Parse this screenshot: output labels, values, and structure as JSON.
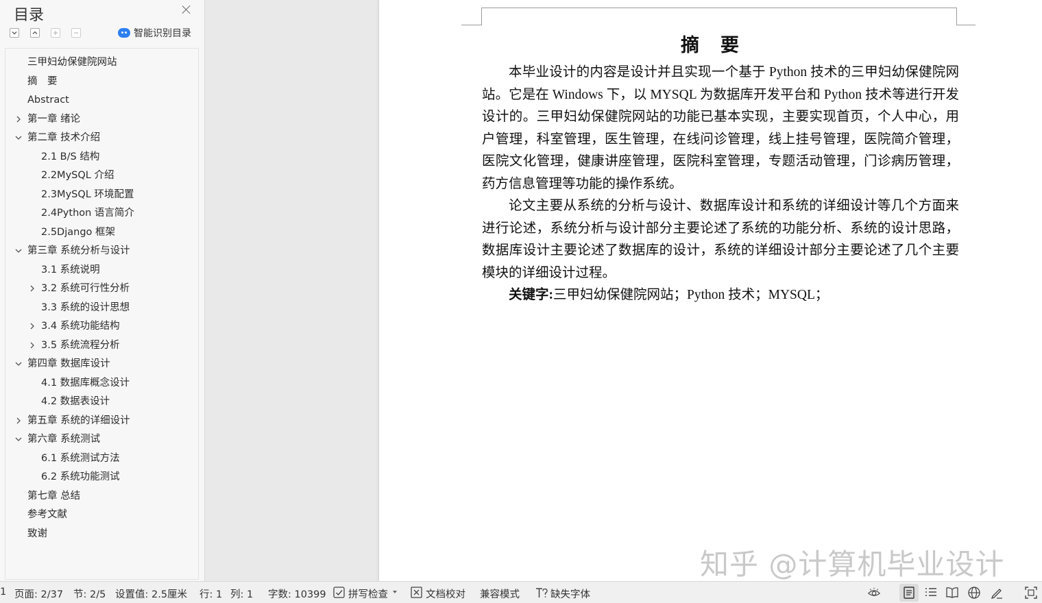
{
  "toc": {
    "title": "目录",
    "smart_toc_label": "智能识别目录",
    "items": [
      {
        "label": "三甲妇幼保健院网站",
        "level": 0,
        "expander": "none"
      },
      {
        "label": "摘　要",
        "level": 0,
        "expander": "none"
      },
      {
        "label": "Abstract",
        "level": 0,
        "expander": "none"
      },
      {
        "label": "第一章 绪论",
        "level": 0,
        "expander": "collapsed"
      },
      {
        "label": "第二章 技术介绍",
        "level": 0,
        "expander": "expanded"
      },
      {
        "label": "2.1 B/S 结构",
        "level": 1,
        "expander": "none"
      },
      {
        "label": "2.2MySQL 介绍",
        "level": 1,
        "expander": "none"
      },
      {
        "label": "2.3MySQL 环境配置",
        "level": 1,
        "expander": "none"
      },
      {
        "label": "2.4Python 语言简介",
        "level": 1,
        "expander": "none"
      },
      {
        "label": "2.5Django 框架",
        "level": 1,
        "expander": "none"
      },
      {
        "label": "第三章 系统分析与设计",
        "level": 0,
        "expander": "expanded"
      },
      {
        "label": "3.1 系统说明",
        "level": 1,
        "expander": "none"
      },
      {
        "label": "3.2 系统可行性分析",
        "level": 1,
        "expander": "collapsed"
      },
      {
        "label": "3.3 系统的设计思想",
        "level": 1,
        "expander": "none"
      },
      {
        "label": "3.4 系统功能结构",
        "level": 1,
        "expander": "collapsed"
      },
      {
        "label": "3.5 系统流程分析",
        "level": 1,
        "expander": "collapsed"
      },
      {
        "label": "第四章 数据库设计",
        "level": 0,
        "expander": "expanded"
      },
      {
        "label": "4.1 数据库概念设计",
        "level": 1,
        "expander": "none"
      },
      {
        "label": "4.2 数据表设计",
        "level": 1,
        "expander": "none"
      },
      {
        "label": "第五章 系统的详细设计",
        "level": 0,
        "expander": "collapsed"
      },
      {
        "label": "第六章 系统测试",
        "level": 0,
        "expander": "expanded"
      },
      {
        "label": "6.1 系统测试方法",
        "level": 1,
        "expander": "none"
      },
      {
        "label": "6.2 系统功能测试",
        "level": 1,
        "expander": "none"
      },
      {
        "label": "第七章 总结",
        "level": 0,
        "expander": "none"
      },
      {
        "label": "参考文献",
        "level": 0,
        "expander": "none"
      },
      {
        "label": "致谢",
        "level": 0,
        "expander": "none"
      }
    ]
  },
  "document": {
    "heading": "摘　要",
    "paragraphs": [
      "本毕业设计的内容是设计并且实现一个基于 Python 技术的三甲妇幼保健院网站。它是在 Windows 下，以 MYSQL 为数据库开发平台和 Python 技术等进行开发设计的。三甲妇幼保健院网站的功能已基本实现，主要实现首页，个人中心，用户管理，科室管理，医生管理，在线问诊管理，线上挂号管理，医院简介管理，医院文化管理，健康讲座管理，医院科室管理，专题活动管理，门诊病历管理，药方信息管理等功能的操作系统。",
      "论文主要从系统的分析与设计、数据库设计和系统的详细设计等几个方面来进行论述，系统分析与设计部分主要论述了系统的功能分析、系统的设计思路，数据库设计主要论述了数据库的设计，系统的详细设计部分主要论述了几个主要模块的详细设计过程。"
    ],
    "keywords_label": "关键字:",
    "keywords_text": "三甲妇幼保健院网站；Python 技术；MYSQL；",
    "watermark": "知乎 @计算机毕业设计"
  },
  "status_bar": {
    "edge_char": "1",
    "page": "页面: 2/37",
    "section": "节: 2/5",
    "setting": "设置值: 2.5厘米",
    "row": "行: 1",
    "col": "列: 1",
    "word_count": "字数: 10399",
    "spell_check": "拼写检查",
    "doc_proof": "文档校对",
    "compat_mode": "兼容模式",
    "missing_font": "缺失字体"
  }
}
